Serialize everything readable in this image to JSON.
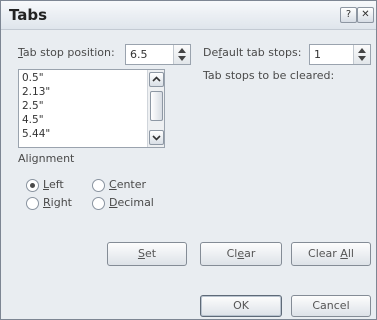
{
  "dialog": {
    "title": "Tabs",
    "help_glyph": "?",
    "close_glyph": "✕"
  },
  "tab_stop": {
    "label_u": "T",
    "label_rest": "ab stop position:",
    "value": "6.5",
    "items": [
      "0.5\"",
      "2.13\"",
      "2.5\"",
      "4.5\"",
      "5.44\""
    ]
  },
  "default_stops": {
    "label_pre": "De",
    "label_u": "f",
    "label_rest": "ault tab stops:",
    "value": "1"
  },
  "to_be_cleared": {
    "label": "Tab stops to be cleared:"
  },
  "alignment": {
    "label": "Alignment",
    "options": [
      {
        "u": "L",
        "rest": "eft",
        "selected": true
      },
      {
        "u": "C",
        "rest": "enter",
        "selected": false
      },
      {
        "u": "R",
        "rest": "ight",
        "selected": false
      },
      {
        "u": "D",
        "rest": "ecimal",
        "selected": false
      }
    ]
  },
  "buttons": {
    "set": {
      "pre": "",
      "u": "S",
      "rest": "et"
    },
    "clear": {
      "pre": "Cl",
      "u": "e",
      "rest": "ar"
    },
    "clear_all": {
      "pre": "Clear ",
      "u": "A",
      "rest": "ll"
    },
    "ok": "OK",
    "cancel": "Cancel"
  }
}
